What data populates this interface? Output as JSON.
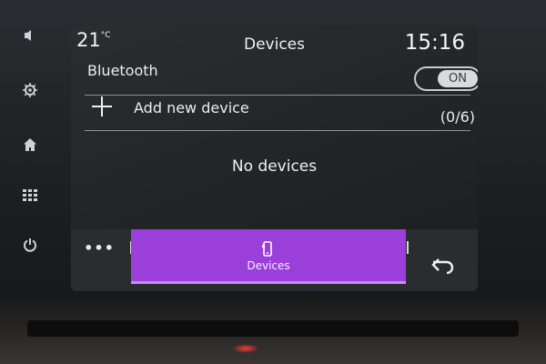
{
  "status": {
    "temperature": "21",
    "temperature_unit": "°C",
    "time": "15:16"
  },
  "header": {
    "title": "Devices"
  },
  "bluetooth": {
    "label": "Bluetooth",
    "toggle_state": "ON"
  },
  "add_device": {
    "label": "Add new device",
    "count": "(0/6)",
    "icon": "plus-icon"
  },
  "device_list": {
    "empty_message": "No devices"
  },
  "bottom_bar": {
    "more_label": "•••",
    "active_tab_label": "Devices",
    "active_tab_icon": "phone-icon",
    "back_icon": "back-arrow-icon",
    "accent_color": "#9a3fd9"
  },
  "side_controls": [
    {
      "icon": "volume-icon"
    },
    {
      "icon": "settings-icon"
    },
    {
      "icon": "home-icon"
    },
    {
      "icon": "apps-grid-icon"
    },
    {
      "icon": "power-icon"
    }
  ]
}
